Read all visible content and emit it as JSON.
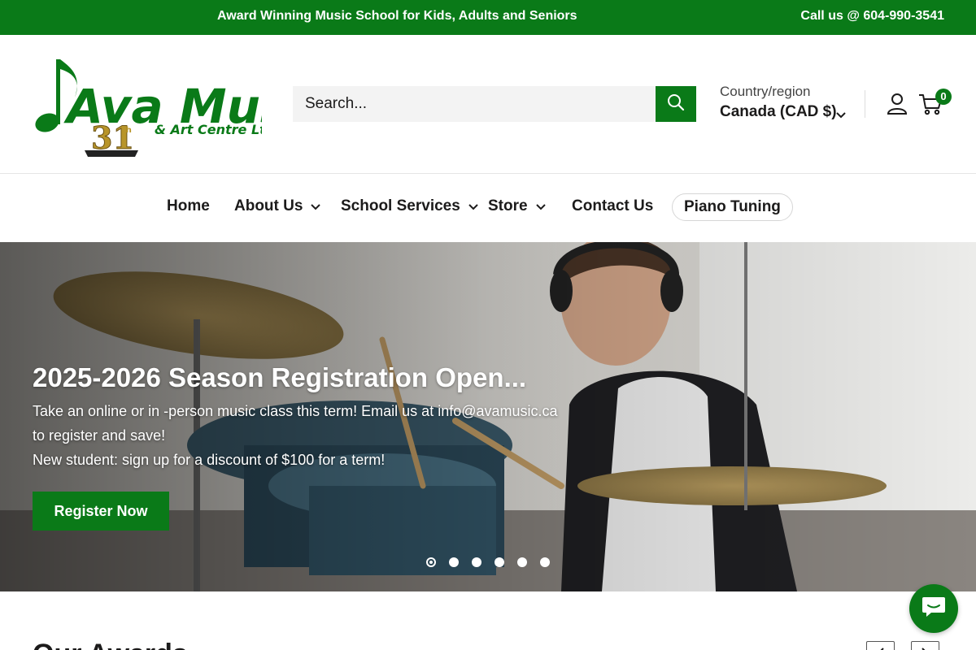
{
  "announcement": {
    "message": "Award Winning Music School for Kids, Adults and Seniors",
    "phone": "Call us @ 604-990-3541"
  },
  "header": {
    "logo": {
      "name": "Ava Music",
      "subtitle": "& Art Centre Ltd.",
      "badge": "31"
    },
    "search": {
      "placeholder": "Search...",
      "value": ""
    },
    "region": {
      "label": "Country/region",
      "value": "Canada (CAD $)"
    },
    "cart_count": "0"
  },
  "nav": {
    "items": [
      {
        "label": "Home",
        "dropdown": false
      },
      {
        "label": "About Us",
        "dropdown": true
      },
      {
        "label": "School Services",
        "dropdown": true
      },
      {
        "label": "Store",
        "dropdown": true
      },
      {
        "label": "Contact Us",
        "dropdown": false
      }
    ],
    "pill": "Piano Tuning"
  },
  "hero": {
    "title": "2025-2026 Season Registration Open...",
    "text_line1": "Take an online or in -person music class this term! Email us at info@avamusic.ca to register and save!",
    "text_line2": "New student: sign up for a discount of $100 for a term!",
    "button": "Register Now",
    "slide_count": 6,
    "active_slide": 1
  },
  "section": {
    "heading": "Our Awards"
  },
  "colors": {
    "brand_green": "#0a7a18",
    "text": "#1c1b1b"
  },
  "icons": [
    "search-icon",
    "chevron-down-icon",
    "account-icon",
    "cart-icon",
    "chat-icon",
    "arrow-left-icon",
    "arrow-right-icon"
  ]
}
